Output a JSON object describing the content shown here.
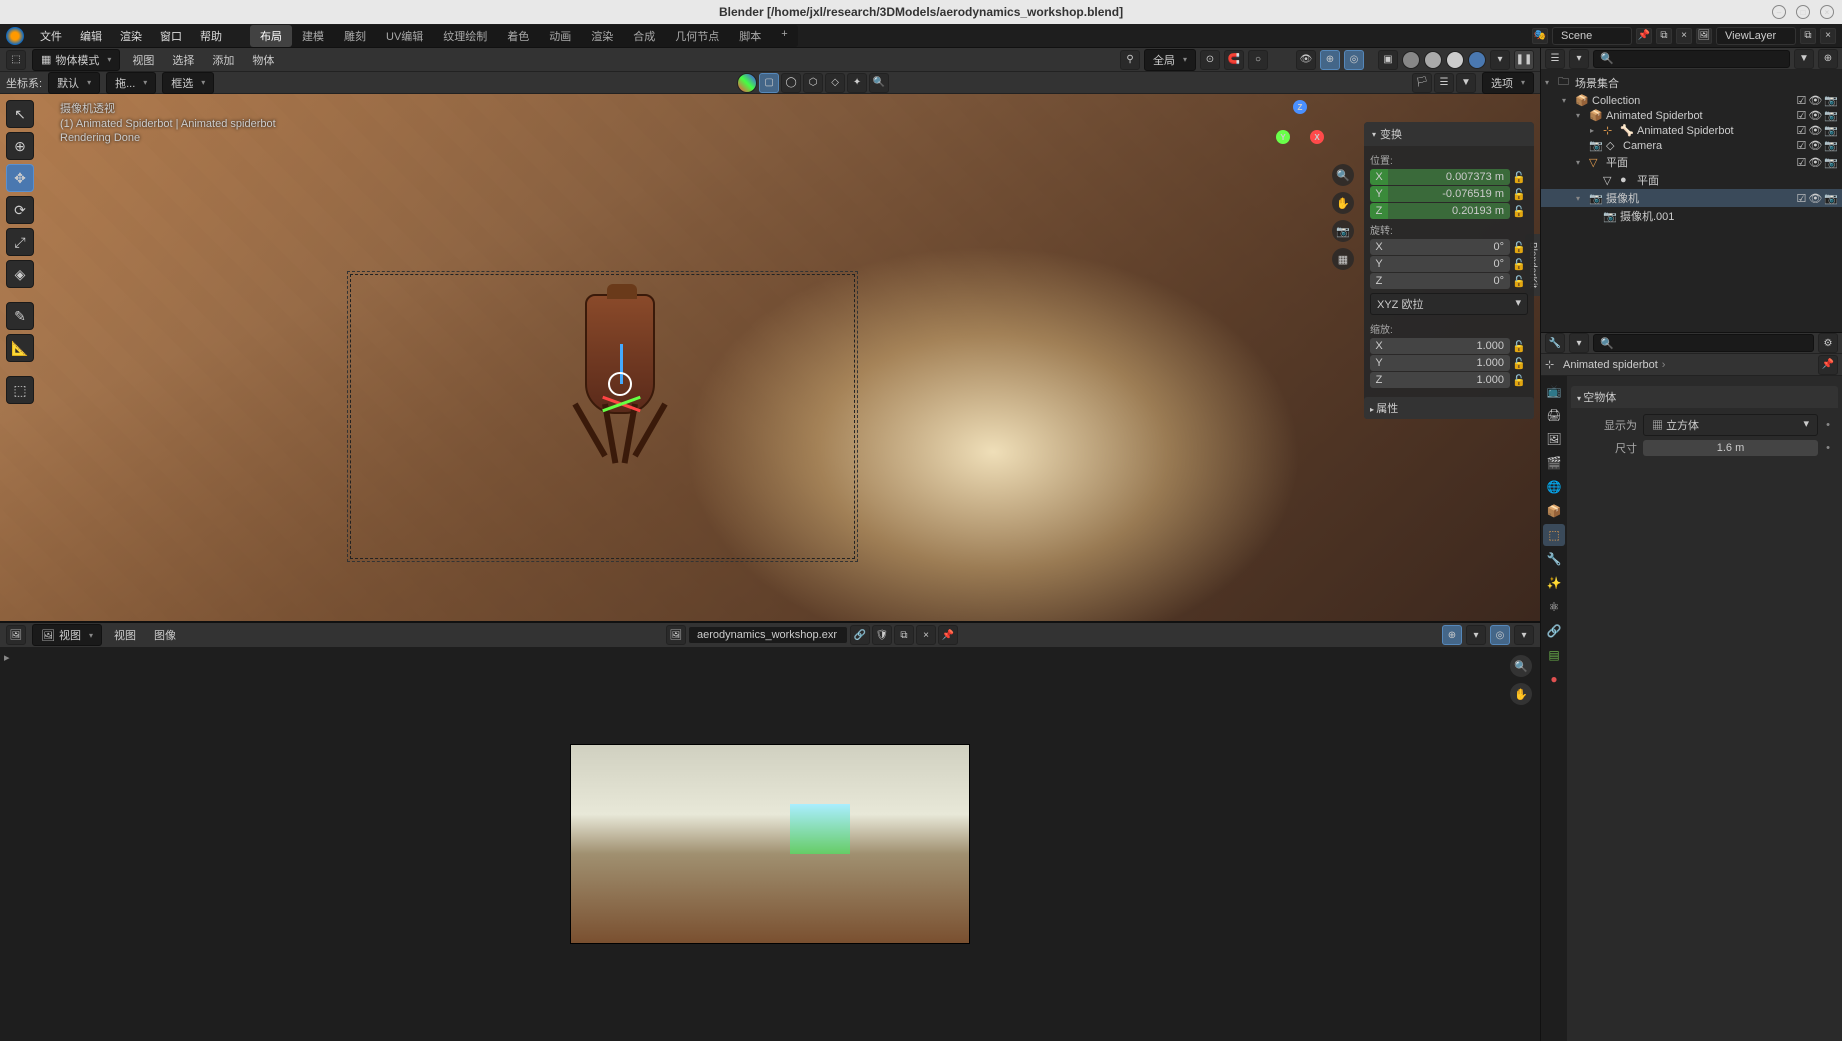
{
  "titlebar": {
    "title": "Blender [/home/jxl/research/3DModels/aerodynamics_workshop.blend]"
  },
  "menu": {
    "file": "文件",
    "edit": "编辑",
    "render": "渲染",
    "window": "窗口",
    "help": "帮助"
  },
  "tabs": {
    "layout": "布局",
    "modeling": "建模",
    "sculpt": "雕刻",
    "uv": "UV编辑",
    "texpaint": "纹理绘制",
    "shading": "着色",
    "anim": "动画",
    "rendering": "渲染",
    "compositing": "合成",
    "geonodes": "几何节点",
    "scripting": "脚本",
    "add": "+"
  },
  "scene": {
    "label": "Scene",
    "viewlayer": "ViewLayer"
  },
  "header3d": {
    "mode": "物体模式",
    "view": "视图",
    "select": "选择",
    "add": "添加",
    "object": "物体",
    "global": "全局"
  },
  "orient": {
    "label": "坐标系:",
    "value": "默认",
    "drag": "拖...",
    "boxsel": "框选"
  },
  "viewport": {
    "persp": "摄像机透视",
    "path": "(1) Animated Spiderbot | Animated spiderbot",
    "status": "Rendering Done",
    "options": "选项",
    "sidetab": "BlenderKit"
  },
  "npanel": {
    "title": "变换",
    "loc_label": "位置:",
    "loc": {
      "x": "0.007373 m",
      "y": "-0.076519 m",
      "z": "0.20193 m"
    },
    "rot_label": "旋转:",
    "rot": {
      "x": "0°",
      "y": "0°",
      "z": "0°"
    },
    "rotmode": "XYZ 欧拉",
    "scale_label": "缩放:",
    "scale": {
      "x": "1.000",
      "y": "1.000",
      "z": "1.000"
    },
    "props": "属性"
  },
  "imged": {
    "view_mode": "视图",
    "view": "视图",
    "image": "图像",
    "filename": "aerodynamics_workshop.exr"
  },
  "outliner": {
    "scene_collection": "场景集合",
    "items": [
      {
        "indent": 1,
        "icon": "📦",
        "label": "Collection",
        "toggle": "▾",
        "ctrls": true
      },
      {
        "indent": 2,
        "icon": "📦",
        "label": "Animated Spiderbot",
        "toggle": "▾",
        "ctrls": true
      },
      {
        "indent": 3,
        "icon": "⊹",
        "iconcls": "col-orange",
        "label": "Animated Spiderbot",
        "toggle": "▸",
        "ctrls": true,
        "extra": "🦴"
      },
      {
        "indent": 2,
        "icon": "📷",
        "iconcls": "col-green",
        "label": "Camera",
        "toggle": "",
        "ctrls": true,
        "extra": "◇"
      },
      {
        "indent": 2,
        "icon": "▽",
        "iconcls": "col-orange",
        "label": "平面",
        "toggle": "▾",
        "ctrls": true
      },
      {
        "indent": 3,
        "icon": "▽",
        "label": "平面",
        "toggle": "",
        "ctrls": false,
        "extra": "●"
      },
      {
        "indent": 2,
        "icon": "📷",
        "iconcls": "col-orange",
        "label": "摄像机",
        "toggle": "▾",
        "ctrls": true,
        "sel": true
      },
      {
        "indent": 3,
        "icon": "📷",
        "iconcls": "col-teal",
        "label": "摄像机.001",
        "toggle": "",
        "ctrls": false
      }
    ]
  },
  "props": {
    "crumb_obj": "Animated spiderbot",
    "panel_title": "空物体",
    "display_as_label": "显示为",
    "display_as_value": "立方体",
    "size_label": "尺寸",
    "size_value": "1.6 m"
  }
}
